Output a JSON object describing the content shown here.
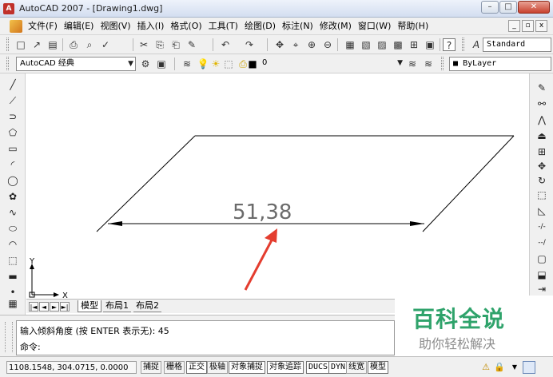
{
  "window": {
    "title": "AutoCAD 2007 - [Drawing1.dwg]",
    "app_icon": "autocad-logo",
    "min": "–",
    "max": "□",
    "close": "✕"
  },
  "menu": {
    "items": [
      "文件(F)",
      "编辑(E)",
      "视图(V)",
      "插入(I)",
      "格式(O)",
      "工具(T)",
      "绘图(D)",
      "标注(N)",
      "修改(M)",
      "窗口(W)",
      "帮助(H)"
    ],
    "mdi_min": "_",
    "mdi_max": "▫",
    "mdi_close": "x"
  },
  "toolbar": {
    "icons": [
      "□",
      "↗",
      "▤",
      "⎙",
      "⌕",
      "✓",
      "✂",
      "⎘",
      "⎗",
      "✎",
      "↶",
      "↷",
      "✥",
      "⌖",
      "⊕",
      "⊖",
      "▦",
      "▧",
      "▨",
      "▩",
      "⊞",
      "▣",
      "?"
    ],
    "text_style": "Standard"
  },
  "workspace": {
    "name": "AutoCAD 经典",
    "layer_value": "0",
    "color_value": "ByLayer"
  },
  "left_tools": [
    "╱",
    "⟋",
    "⊃",
    "⬠",
    "▭",
    "◜",
    "◯",
    "✿",
    "∿",
    "⬭",
    "◠",
    "⬚",
    "▬",
    "•",
    "▦"
  ],
  "right_tools": [
    "✎",
    "⚯",
    "⋀",
    "⏏",
    "⊞",
    "✥",
    "↻",
    "⬚",
    "◺",
    "-/-",
    "--/",
    "▢",
    "⬓",
    "⇥",
    "◸"
  ],
  "drawing": {
    "dimension_text": "51,38",
    "ucs_x": "X",
    "ucs_y": "Y"
  },
  "tabs": {
    "nav": [
      "|◄",
      "◄",
      "►",
      "►|"
    ],
    "model": "模型",
    "layout1": "布局1",
    "layout2": "布局2"
  },
  "command": {
    "history": "输入倾斜角度 (按 ENTER 表示无): 45",
    "prompt": "命令:"
  },
  "watermark": {
    "title": "百科全说",
    "subtitle": "助你轻松解决"
  },
  "status": {
    "coords": "1108.1548, 304.0715, 0.0000",
    "buttons": [
      {
        "label": "捕捉",
        "on": false
      },
      {
        "label": "栅格",
        "on": false
      },
      {
        "label": "正交",
        "on": true
      },
      {
        "label": "极轴",
        "on": false
      },
      {
        "label": "对象捕捉",
        "on": true
      },
      {
        "label": "对象追踪",
        "on": true
      },
      {
        "label": "DUCS",
        "on": true
      },
      {
        "label": "DYN",
        "on": true
      },
      {
        "label": "线宽",
        "on": false
      },
      {
        "label": "模型",
        "on": true
      }
    ]
  }
}
